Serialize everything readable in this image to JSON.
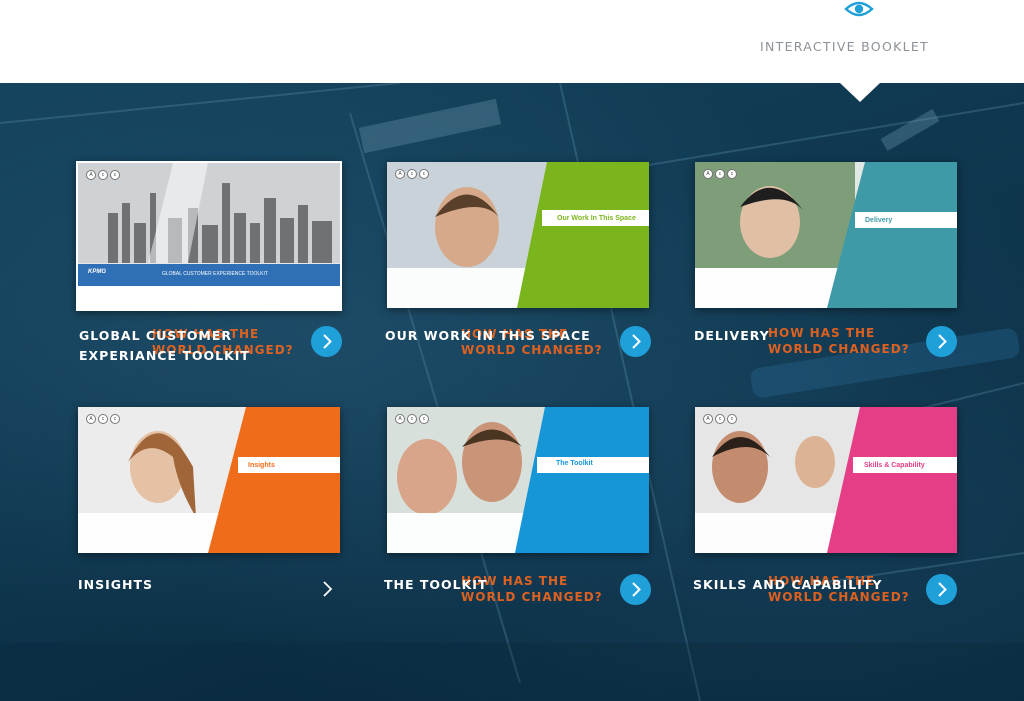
{
  "header": {
    "icon": "eye-icon",
    "booklet_label": "INTERACTIVE BOOKLET"
  },
  "colors": {
    "accent_blue": "#1fa0d8",
    "accent_orange": "#e8641e",
    "green_band": "#7ab51d",
    "teal_band": "#3f9aa8",
    "orange_band": "#ef6d1a",
    "blue_band": "#1696d6",
    "pink_band": "#e53d86"
  },
  "cover": {
    "brand": "KPMG",
    "title": "GLOBAL CUSTOMER EXPERIENCE TOOLKIT"
  },
  "cards": [
    {
      "title_line1": "GLOBAL CUSTOMER",
      "title_line2": "EXPERIANCE TOOLKIT",
      "changed_line1": "HOW HAS THE",
      "changed_line2": "WORLD CHANGED?",
      "band_label": "",
      "button_icon": "chevron-right-icon"
    },
    {
      "title_line1": "OUR WORK IN THIS SPACE",
      "title_line2": "",
      "changed_line1": "HOW HAS THE",
      "changed_line2": "WORLD CHANGED?",
      "band_label": "Our Work In This Space",
      "button_icon": "chevron-right-icon"
    },
    {
      "title_line1": "DELIVERY",
      "title_line2": "",
      "changed_line1": "HOW HAS THE",
      "changed_line2": "WORLD CHANGED?",
      "band_label": "Delivery",
      "button_icon": "chevron-right-icon"
    },
    {
      "title_line1": "INSIGHTS",
      "title_line2": "",
      "changed_line1": "",
      "changed_line2": "",
      "band_label": "Insights",
      "button_icon": "chevron-right-icon"
    },
    {
      "title_line1": "THE TOOLKIT",
      "title_line2": "",
      "changed_line1": "HOW HAS THE",
      "changed_line2": "WORLD CHANGED?",
      "band_label": "The Toolkit",
      "button_icon": "chevron-right-icon"
    },
    {
      "title_line1": "SKILLS AND CAPABILITY",
      "title_line2": "",
      "changed_line1": "HOW HAS THE",
      "changed_line2": "WORLD CHANGED?",
      "band_label": "Skills & Capability",
      "button_icon": "chevron-right-icon"
    }
  ]
}
